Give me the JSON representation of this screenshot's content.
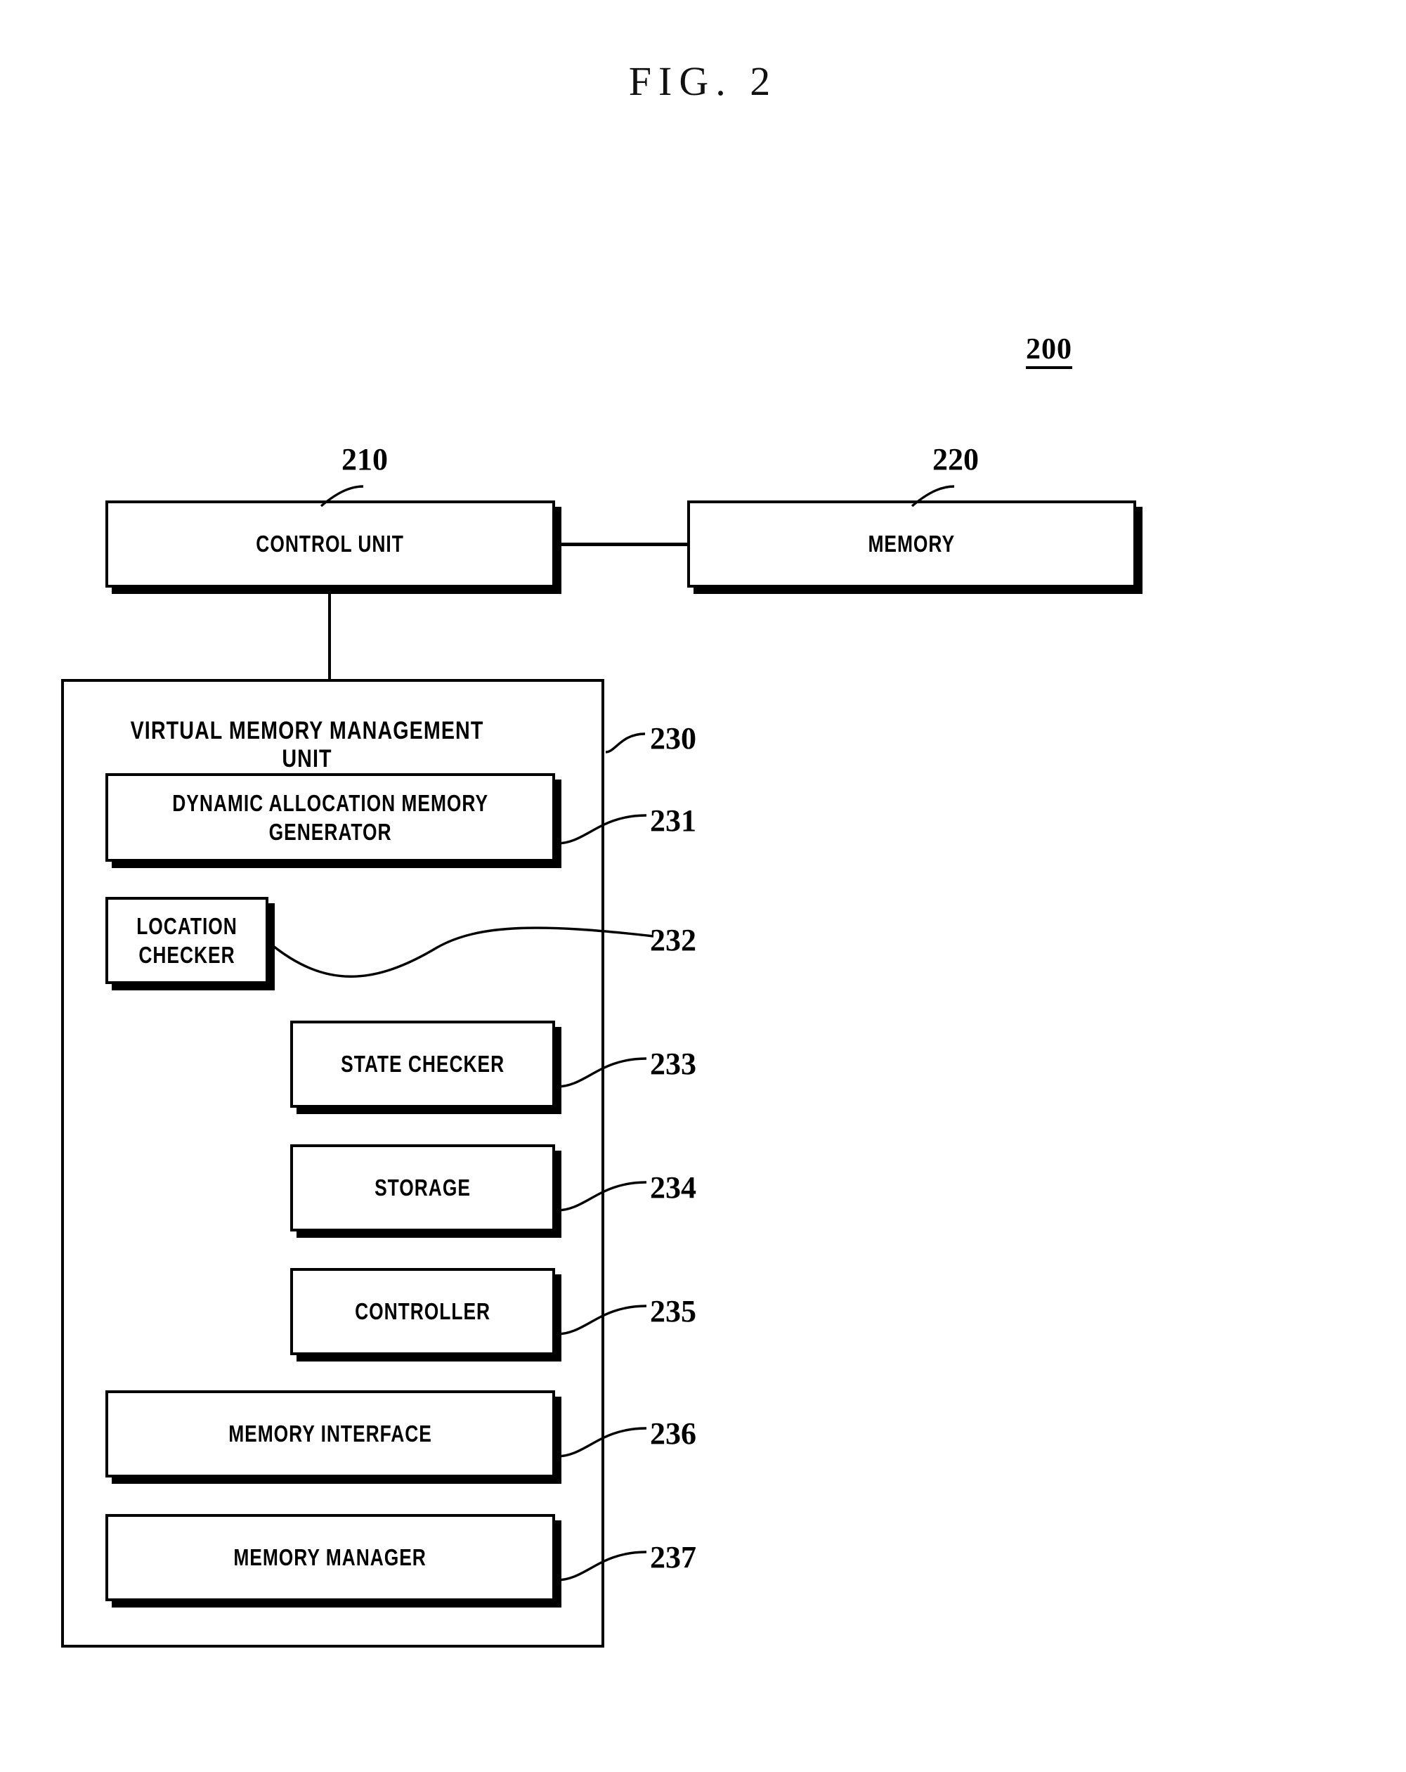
{
  "figure": {
    "title": "FIG. 2",
    "system_ref": "200"
  },
  "diagram": {
    "type": "block-diagram",
    "blocks": [
      {
        "id": "210",
        "label": "CONTROL UNIT",
        "ref": "210"
      },
      {
        "id": "220",
        "label": "MEMORY",
        "ref": "220"
      },
      {
        "id": "230",
        "label": "VIRTUAL MEMORY MANAGEMENT UNIT",
        "ref": "230"
      },
      {
        "id": "231",
        "label": "DYNAMIC ALLOCATION MEMORY\nGENERATOR",
        "ref": "231"
      },
      {
        "id": "232",
        "label": "LOCATION CHECKER",
        "ref": "232"
      },
      {
        "id": "233",
        "label": "STATE CHECKER",
        "ref": "233"
      },
      {
        "id": "234",
        "label": "STORAGE",
        "ref": "234"
      },
      {
        "id": "235",
        "label": "CONTROLLER",
        "ref": "235"
      },
      {
        "id": "236",
        "label": "MEMORY INTERFACE",
        "ref": "236"
      },
      {
        "id": "237",
        "label": "MEMORY MANAGER",
        "ref": "237"
      }
    ],
    "connections": [
      {
        "from": "210",
        "to": "220",
        "style": "straight-horizontal"
      },
      {
        "from": "210",
        "to": "230",
        "style": "straight-vertical"
      }
    ],
    "colors": {
      "stroke": "#000000",
      "fill": "#ffffff",
      "shadow": "#000000"
    }
  }
}
